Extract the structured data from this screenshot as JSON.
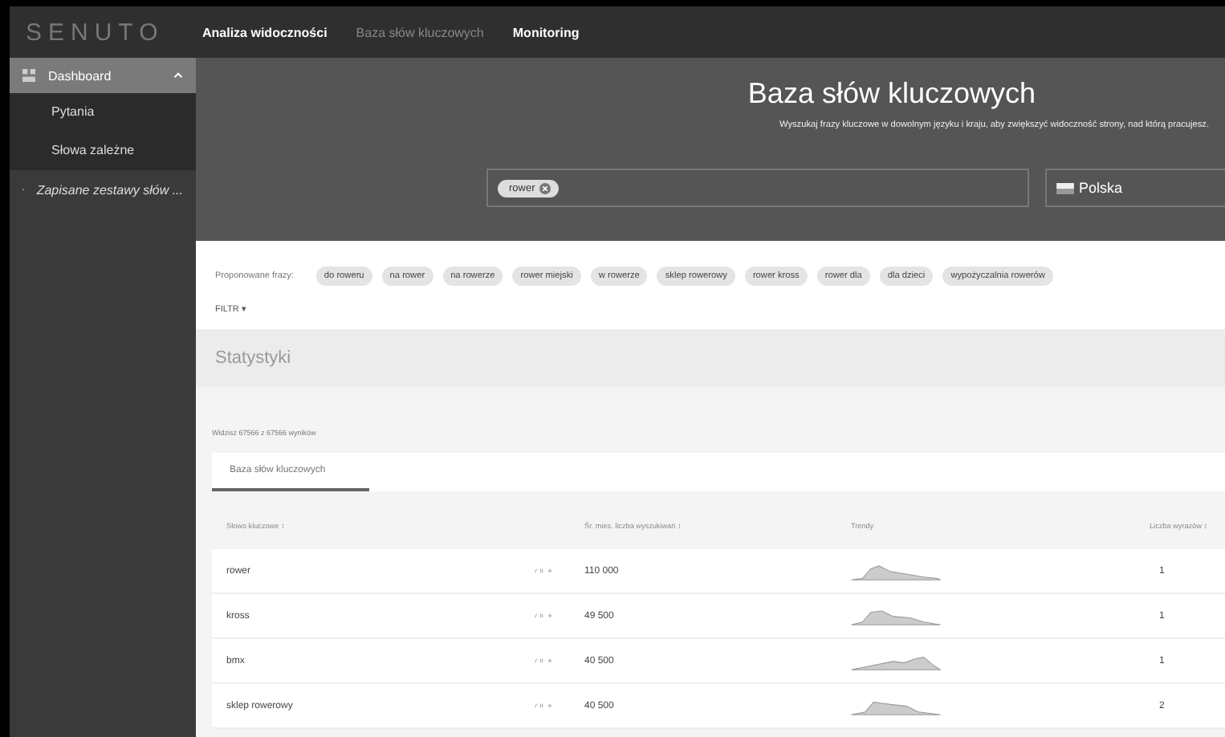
{
  "topbar": {
    "logo": "SENUTO",
    "nav": [
      {
        "label": "Analiza widoczności",
        "dimmed": false
      },
      {
        "label": "Baza słów kluczowych",
        "dimmed": true
      },
      {
        "label": "Monitoring",
        "dimmed": false
      }
    ]
  },
  "sidebar": {
    "items": [
      {
        "label": "Dashboard",
        "selected": true,
        "expanded": true,
        "children": [
          {
            "label": "Pytania"
          },
          {
            "label": "Słowa zależne"
          }
        ]
      },
      {
        "label": "Zapisane zestawy słów ...",
        "selected": false,
        "expanded": false
      }
    ]
  },
  "header": {
    "title": "Baza słów kluczowych",
    "subtitle": "Wyszukaj frazy kluczowe w dowolnym języku i kraju, aby zwiększyć widoczność strony, nad którą pracujesz.",
    "search_tags": [
      "rower"
    ],
    "country": "Polska"
  },
  "suggestions": {
    "label": "Proponowane frazy:",
    "chips": [
      "do roweru",
      "na rower",
      "na rowerze",
      "rower miejski",
      "w rowerze",
      "sklep rowerowy",
      "rower kross",
      "rower dla",
      "dla dzieci",
      "wypożyczalnia rowerów"
    ],
    "filter": "FILTR ▾"
  },
  "stats": {
    "title": "Statystyki"
  },
  "results": {
    "count": "Widzisz 67566 z 67566 wyników",
    "tabs": [
      {
        "label": "Baza słów kluczowych",
        "selected": true
      }
    ],
    "columns": [
      "Słowo kluczowe ↕",
      "Śr. mies. liczba wyszukiwań ↕",
      "Trendy",
      "Liczba wyrazów ↕"
    ],
    "rows": [
      {
        "keyword": "rower",
        "volume": "110 000",
        "words": "1"
      },
      {
        "keyword": "kross",
        "volume": "49 500",
        "words": "1"
      },
      {
        "keyword": "bmx",
        "volume": "40 500",
        "words": "1"
      },
      {
        "keyword": "sklep rowerowy",
        "volume": "40 500",
        "words": "2"
      }
    ]
  }
}
